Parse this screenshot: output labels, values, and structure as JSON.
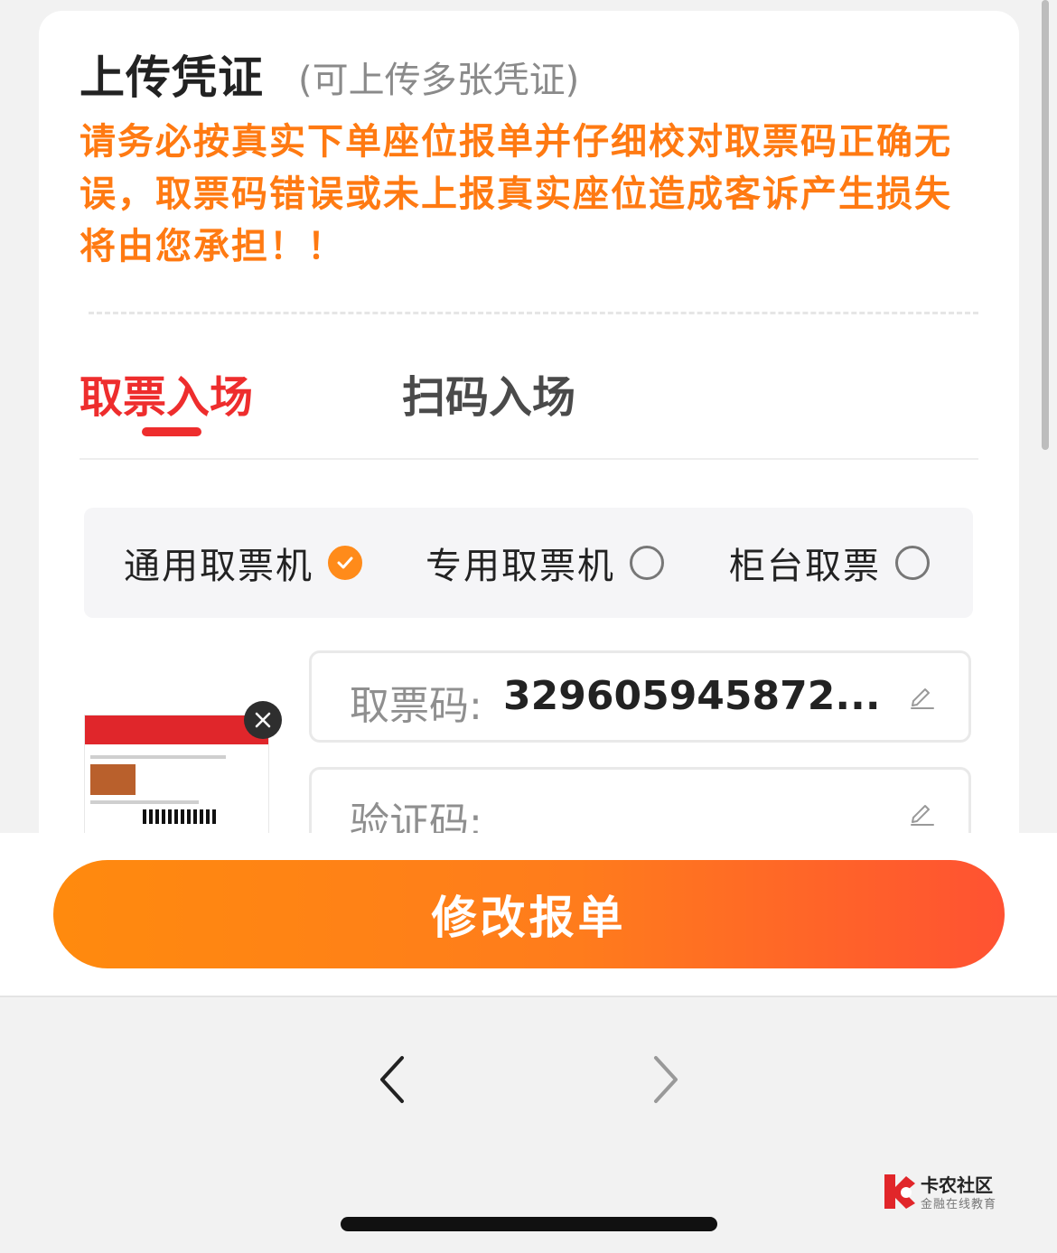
{
  "upload": {
    "title": "上传凭证",
    "subtitle": "(可上传多张凭证)",
    "warning": "请务必按真实下单座位报单并仔细校对取票码正确无误，取票码错误或未上报真实座位造成客诉产生损失将由您承担！！"
  },
  "tabs": [
    {
      "label": "取票入场",
      "active": true
    },
    {
      "label": "扫码入场",
      "active": false
    }
  ],
  "options": [
    {
      "label": "通用取票机",
      "checked": true
    },
    {
      "label": "专用取票机",
      "checked": false
    },
    {
      "label": "柜台取票",
      "checked": false
    }
  ],
  "fields": {
    "ticket_label": "取票码:",
    "ticket_value": "329605945872...",
    "verify_label": "验证码:"
  },
  "actions": {
    "submit_label": "修改报单"
  },
  "watermark": {
    "title": "卡农社区",
    "subtitle": "金融在线教育"
  },
  "colors": {
    "accent_orange": "#ff7a12",
    "tab_active_red": "#ee2d2d",
    "button_start": "#ff8a0e",
    "button_end": "#ff5232"
  }
}
